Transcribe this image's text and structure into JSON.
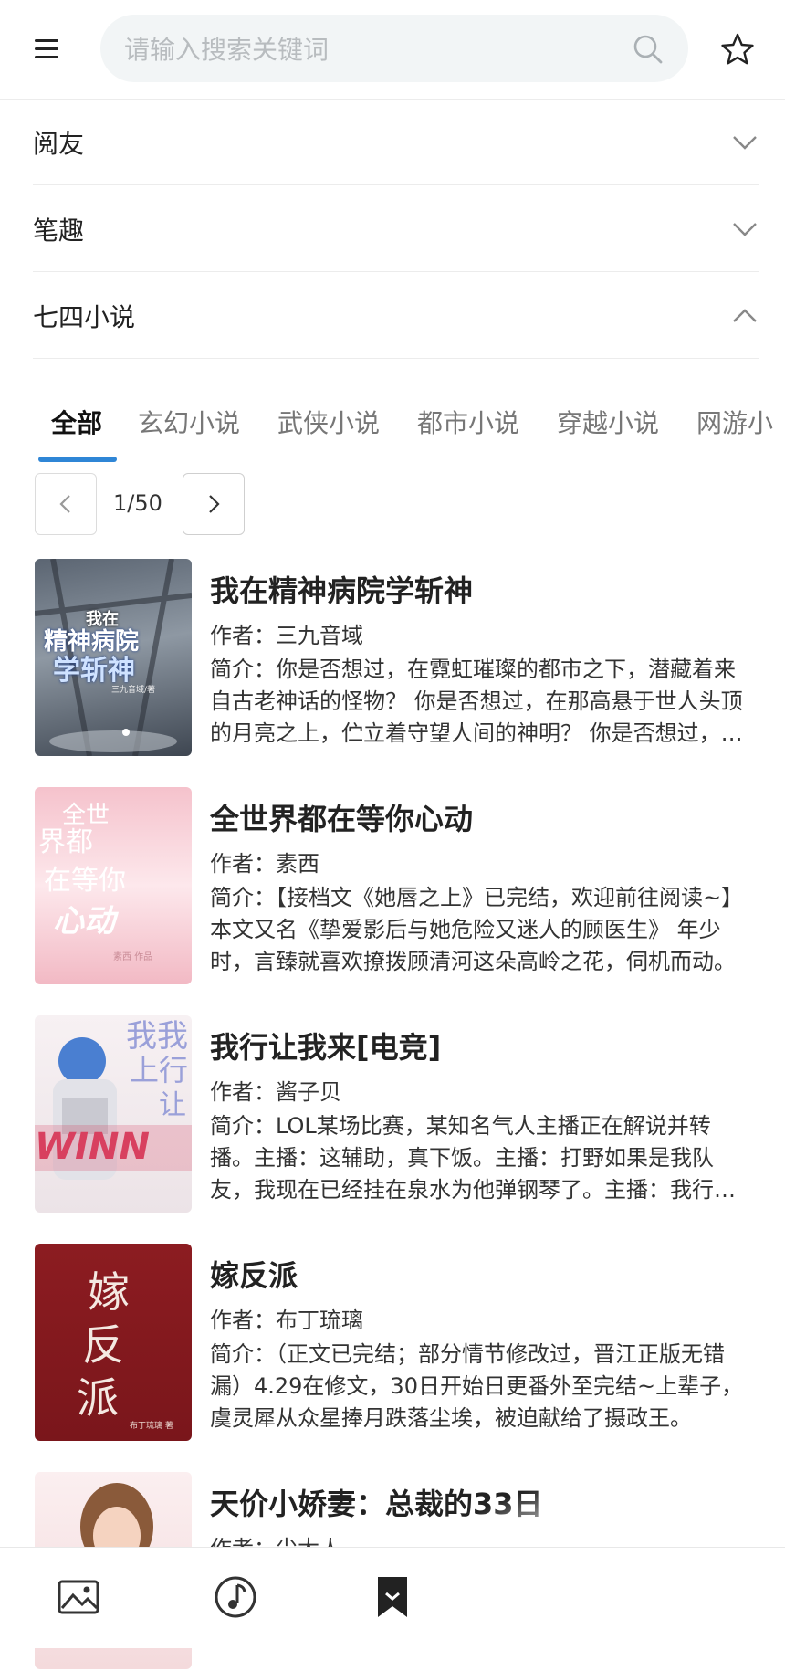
{
  "search": {
    "placeholder": "请输入搜索关键词"
  },
  "sources": [
    {
      "label": "阅友",
      "expanded": false
    },
    {
      "label": "笔趣",
      "expanded": false
    },
    {
      "label": "七四小说",
      "expanded": true
    }
  ],
  "tabs": [
    {
      "label": "全部",
      "active": true
    },
    {
      "label": "玄幻小说",
      "active": false
    },
    {
      "label": "武侠小说",
      "active": false
    },
    {
      "label": "都市小说",
      "active": false
    },
    {
      "label": "穿越小说",
      "active": false
    },
    {
      "label": "网游小",
      "active": false
    }
  ],
  "pager": {
    "text": "1/50"
  },
  "books": [
    {
      "title": "我在精神病院学斩神",
      "author": "作者：三九音域",
      "desc": "简介：你是否想过，在霓虹璀璨的都市之下，潜藏着来自古老神话的怪物？ 你是否想过，在那高悬于世人头顶的月亮之上，伫立着守望人间的神明？ 你是否想过，在那些看似平凡的人们之中，有人为守护这一切而战？",
      "cover_text": [
        "我在",
        "精神病院",
        "学斩神",
        "三九音域/著"
      ],
      "cover_colors": [
        "#4c5563",
        "#9aa3ad"
      ]
    },
    {
      "title": "全世界都在等你心动",
      "author": "作者：素西",
      "desc": "简介：【接档文《她唇之上》已完结，欢迎前往阅读~】本文又名《挚爱影后与她危险又迷人的顾医生》 年少时，言臻就喜欢撩拨顾清河这朵高岭之花，伺机而动。",
      "cover_text": [
        "全世",
        "界都",
        "在等你",
        "心动",
        "素西 作品"
      ],
      "cover_colors": [
        "#f3c6cf",
        "#fbe6ea"
      ]
    },
    {
      "title": "我行让我来[电竞]",
      "author": "作者：酱子贝",
      "desc": "简介：LOL某场比赛，某知名气人主播正在解说并转播。主播：这辅助，真下饭。主播：打野如果是我队友，我现在已经挂在泉水为他弹钢琴了。主播：我行我上。",
      "cover_text": [
        "我我",
        "上行",
        "让",
        "WINN"
      ],
      "cover_colors": [
        "#f6eef0",
        "#e9dfe3"
      ]
    },
    {
      "title": "嫁反派",
      "author": "作者：布丁琉璃",
      "desc": "简介：（正文已完结；部分情节修改过，晋江正版无错漏）4.29在修文，30日开始日更番外至完结~上辈子，虞灵犀从众星捧月跌落尘埃，被迫献给了摄政王。",
      "cover_text": [
        "嫁",
        "反",
        "派",
        "布丁琉璃 著"
      ],
      "cover_colors": [
        "#8b1a1f",
        "#a32328"
      ]
    },
    {
      "title": "天价小娇妻：总裁的33日",
      "author": "作者：尖大人",
      "desc": "",
      "cover_text": [],
      "cover_colors": [
        "#f7e1e3",
        "#fbeff0"
      ]
    }
  ],
  "nav": [
    {
      "icon": "image-icon"
    },
    {
      "icon": "music-icon"
    },
    {
      "icon": "bookmark-icon",
      "active": true
    }
  ]
}
